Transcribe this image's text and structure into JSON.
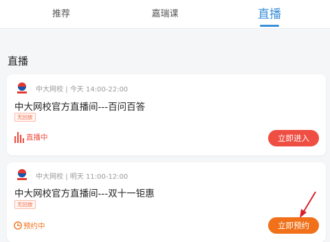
{
  "tabs": [
    "推荐",
    "嘉瑞课",
    "直播"
  ],
  "section_title": "直播",
  "cards": [
    {
      "org": "中大网校",
      "time": "今天 14:00-22:00",
      "title": "中大网校官方直播间---百问百答",
      "tag": "无回放",
      "status": "直播中",
      "button": "立即进入"
    },
    {
      "org": "中大网校",
      "time": "明天 11:00-12:00",
      "title": "中大网校官方直播间---双十一钜惠",
      "tag": "无回放",
      "status": "预约中",
      "button": "立即预约"
    }
  ],
  "colors": {
    "accent_blue": "#3a8fd9",
    "live_red": "#ef4e43",
    "reserve_orange": "#f0711a"
  }
}
